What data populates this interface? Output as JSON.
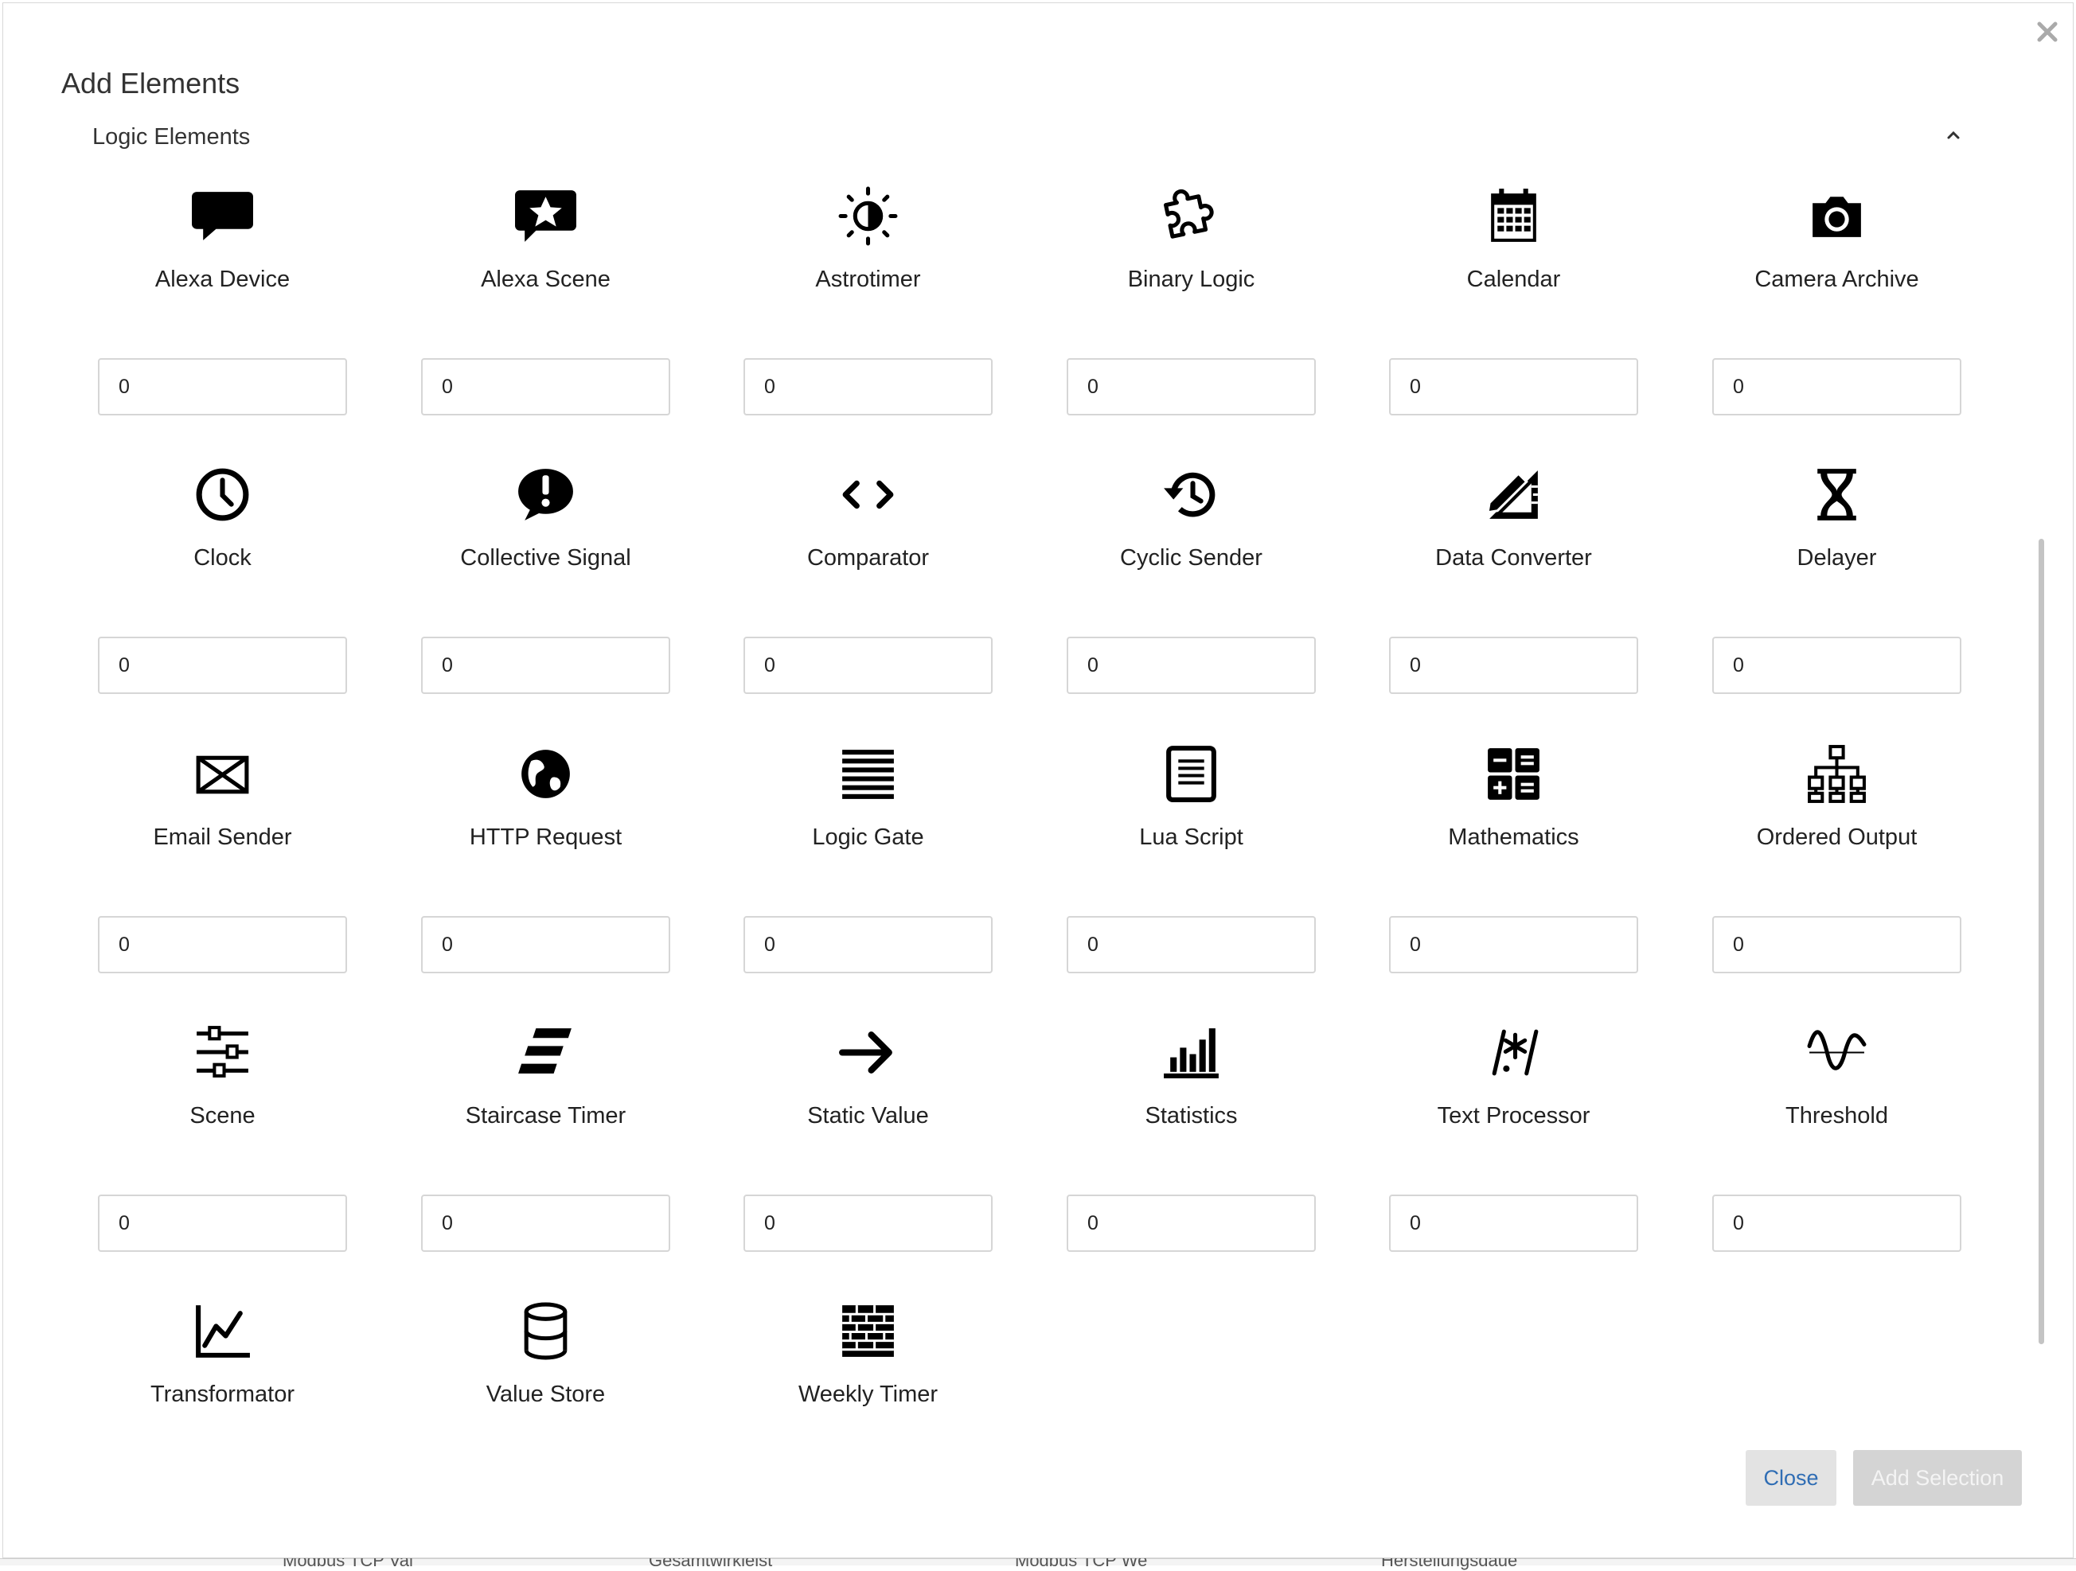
{
  "dialog": {
    "title": "Add Elements",
    "section_title": "Logic Elements",
    "close_icon": "close-icon",
    "collapse_icon": "chevron-up-icon"
  },
  "items": [
    {
      "label": "Alexa Device",
      "icon": "speech-bubble-icon",
      "value": "0"
    },
    {
      "label": "Alexa Scene",
      "icon": "star-bubble-icon",
      "value": "0"
    },
    {
      "label": "Astrotimer",
      "icon": "sun-icon",
      "value": "0"
    },
    {
      "label": "Binary Logic",
      "icon": "puzzle-icon",
      "value": "0"
    },
    {
      "label": "Calendar",
      "icon": "calendar-icon",
      "value": "0"
    },
    {
      "label": "Camera Archive",
      "icon": "camera-icon",
      "value": "0"
    },
    {
      "label": "Clock",
      "icon": "clock-icon",
      "value": "0"
    },
    {
      "label": "Collective Signal",
      "icon": "exclamation-bubble-icon",
      "value": "0"
    },
    {
      "label": "Comparator",
      "icon": "angle-brackets-icon",
      "value": "0"
    },
    {
      "label": "Cyclic Sender",
      "icon": "history-icon",
      "value": "0"
    },
    {
      "label": "Data Converter",
      "icon": "pencil-ruler-icon",
      "value": "0"
    },
    {
      "label": "Delayer",
      "icon": "hourglass-icon",
      "value": "0"
    },
    {
      "label": "Email Sender",
      "icon": "envelope-icon",
      "value": "0"
    },
    {
      "label": "HTTP Request",
      "icon": "globe-icon",
      "value": "0"
    },
    {
      "label": "Logic Gate",
      "icon": "lines-icon",
      "value": "0"
    },
    {
      "label": "Lua Script",
      "icon": "document-icon",
      "value": "0"
    },
    {
      "label": "Mathematics",
      "icon": "calculator-icon",
      "value": "0"
    },
    {
      "label": "Ordered Output",
      "icon": "sitemap-icon",
      "value": "0"
    },
    {
      "label": "Scene",
      "icon": "sliders-icon",
      "value": "0"
    },
    {
      "label": "Staircase Timer",
      "icon": "stairs-icon",
      "value": "0"
    },
    {
      "label": "Static Value",
      "icon": "arrow-right-icon",
      "value": "0"
    },
    {
      "label": "Statistics",
      "icon": "bar-chart-icon",
      "value": "0"
    },
    {
      "label": "Text Processor",
      "icon": "regex-icon",
      "value": "0"
    },
    {
      "label": "Threshold",
      "icon": "wave-icon",
      "value": "0"
    },
    {
      "label": "Transformator",
      "icon": "line-chart-icon",
      "value": ""
    },
    {
      "label": "Value Store",
      "icon": "database-icon",
      "value": ""
    },
    {
      "label": "Weekly Timer",
      "icon": "brick-wall-icon",
      "value": ""
    }
  ],
  "buttons": {
    "close": "Close",
    "add_selection": "Add Selection"
  },
  "background": {
    "cells": [
      "Modbus TCP Val",
      "Gesamtwirkleist",
      "Modbus TCP We",
      "Herstellungsdaue"
    ]
  }
}
